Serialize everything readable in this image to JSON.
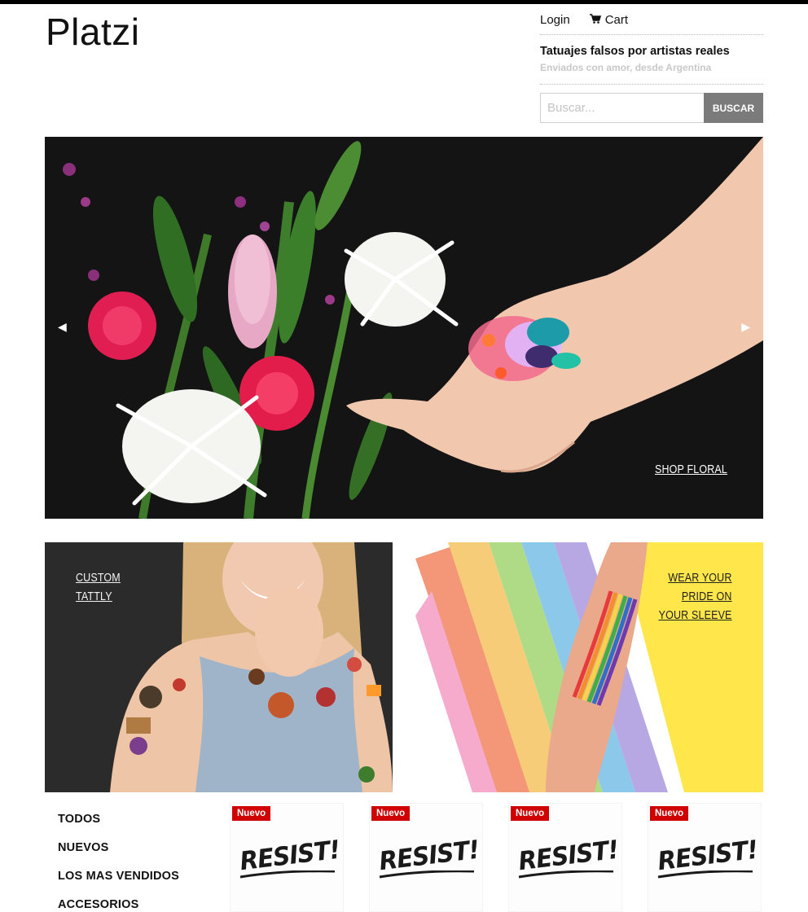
{
  "brand": {
    "logo": "Platzi"
  },
  "header": {
    "login_label": "Login",
    "cart_label": "Cart",
    "tagline": "Tatuajes falsos por artistas reales",
    "subtagline": "Enviados con amor, desde Argentina"
  },
  "search": {
    "placeholder": "Buscar...",
    "button_label": "BUSCAR"
  },
  "hero": {
    "cta_label": "SHOP FLORAL"
  },
  "banners": {
    "left": {
      "line1": "CUSTOM",
      "line2": "TATTLY"
    },
    "right": {
      "line1": "WEAR YOUR",
      "line2": "PRIDE ON",
      "line3": "YOUR SLEEVE"
    }
  },
  "categories": [
    {
      "label": "TODOS"
    },
    {
      "label": "NUEVOS"
    },
    {
      "label": "LOS MAS VENDIDOS"
    },
    {
      "label": "ACCESORIOS"
    }
  ],
  "products": [
    {
      "badge": "Nuevo",
      "title": "RESIST!"
    },
    {
      "badge": "Nuevo",
      "title": "RESIST!"
    },
    {
      "badge": "Nuevo",
      "title": "RESIST!"
    },
    {
      "badge": "Nuevo",
      "title": "RESIST!"
    }
  ],
  "colors": {
    "badge": "#d00000",
    "search_button": "#7b7b7b",
    "right_banner_bg": "#ffe64a"
  },
  "icons": {
    "cart": "cart-icon",
    "prev": "arrow-left-icon",
    "next": "arrow-right-icon"
  }
}
